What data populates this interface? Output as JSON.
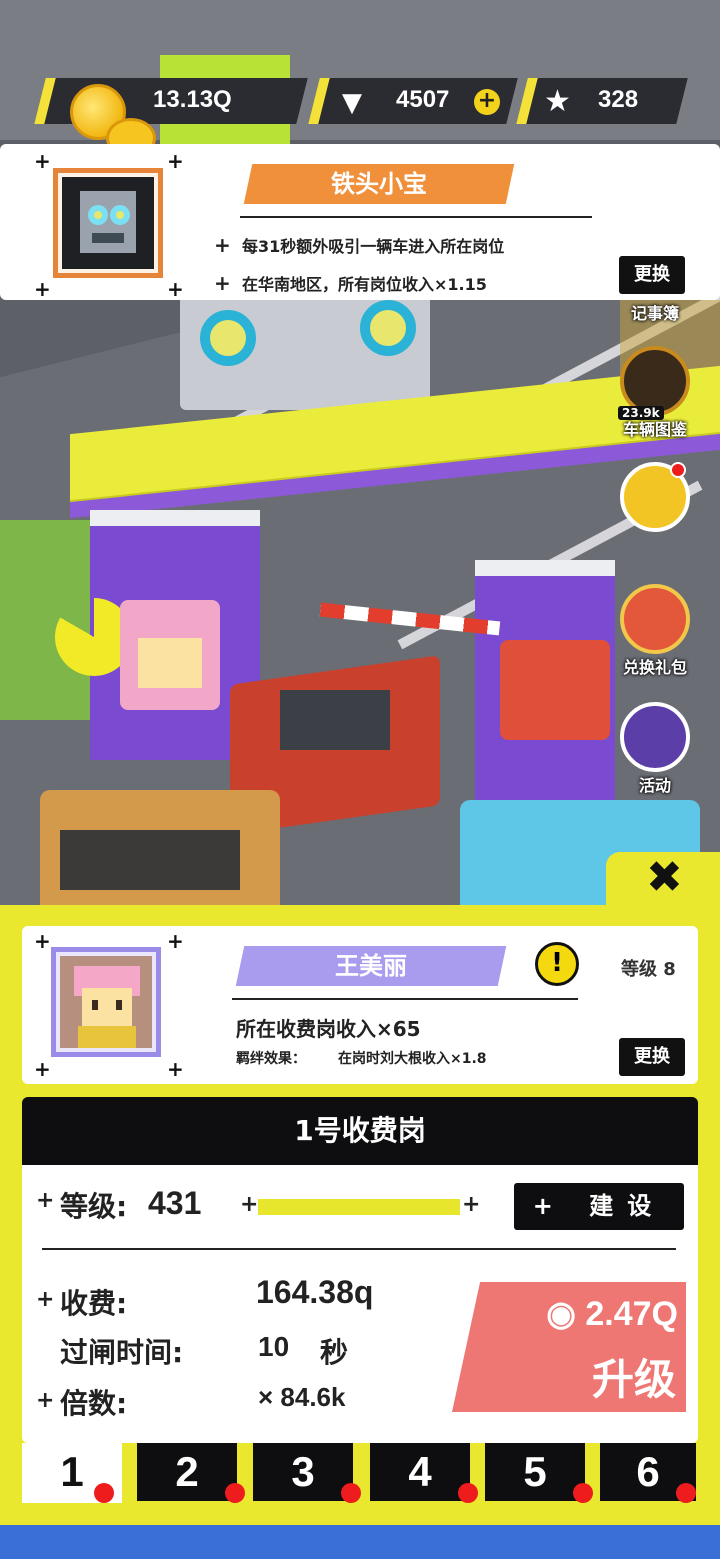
{
  "resources": {
    "coins": "13.13Q",
    "gems": "4507",
    "gems_add": "+",
    "stars": "328"
  },
  "hero": {
    "name": "铁头小宝",
    "effects": [
      "每31秒额外吸引一辆车进入所在岗位",
      "在华南地区，所有岗位收入×1.15"
    ],
    "change_label": "更换"
  },
  "side_menu": [
    {
      "label": "记事簿"
    },
    {
      "label": "车辆图鉴",
      "badge": "23.9k"
    },
    {
      "label": ""
    },
    {
      "label": "兑换礼包"
    },
    {
      "label": "活动"
    }
  ],
  "staff": {
    "name": "王美丽",
    "level": "等级 8",
    "warning": "!",
    "bonus": "所在收费岗收入×65",
    "bond_label": "羁绊效果：",
    "bond_value": "在岗时刘大根收入×1.8",
    "change_label": "更换"
  },
  "station": {
    "title": "1号收费岗",
    "level_label": "等级:",
    "level_value": "431",
    "level_progress": 1.0,
    "build_label": "建设",
    "fee_label": "收费:",
    "fee_value": "164.38q",
    "time_label": "过闸时间:",
    "time_value": "10",
    "time_unit": "秒",
    "multiplier_label": "倍数:",
    "multiplier_value": "× 84.6k",
    "upgrade_cost": "◉ 2.47Q",
    "upgrade_label": "升级"
  },
  "tabs": [
    "1",
    "2",
    "3",
    "4",
    "5",
    "6"
  ],
  "colors": {
    "accent_yellow": "#e9e82f",
    "hero_orange": "#f0903a",
    "staff_purple": "#a99bee",
    "upgrade_red": "#ee7774",
    "dark": "#0e0e10"
  }
}
